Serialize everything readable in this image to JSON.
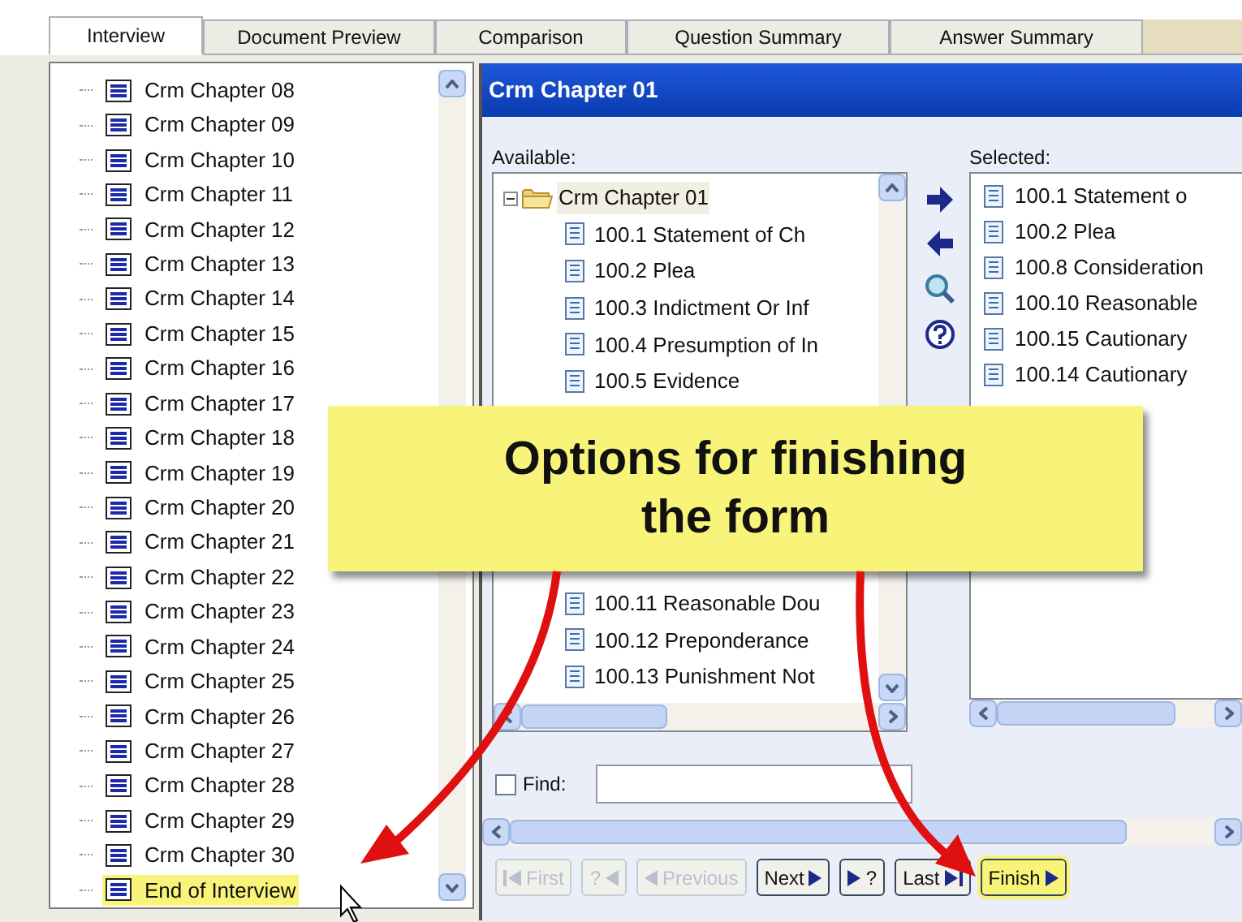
{
  "tabs": [
    {
      "label": "Interview",
      "selected": true
    },
    {
      "label": "Document Preview",
      "selected": false
    },
    {
      "label": "Comparison",
      "selected": false
    },
    {
      "label": "Question Summary",
      "selected": false
    },
    {
      "label": "Answer Summary",
      "selected": false
    }
  ],
  "outline": {
    "items": [
      {
        "label": "Crm Chapter 08",
        "selected": false
      },
      {
        "label": "Crm Chapter 09",
        "selected": false
      },
      {
        "label": "Crm Chapter 10",
        "selected": false
      },
      {
        "label": "Crm Chapter 11",
        "selected": false
      },
      {
        "label": "Crm Chapter 12",
        "selected": false
      },
      {
        "label": "Crm Chapter 13",
        "selected": false
      },
      {
        "label": "Crm Chapter 14",
        "selected": false
      },
      {
        "label": "Crm Chapter 15",
        "selected": false
      },
      {
        "label": "Crm Chapter 16",
        "selected": false
      },
      {
        "label": "Crm Chapter 17",
        "selected": false
      },
      {
        "label": "Crm Chapter 18",
        "selected": false
      },
      {
        "label": "Crm Chapter 19",
        "selected": false
      },
      {
        "label": "Crm Chapter 20",
        "selected": false
      },
      {
        "label": "Crm Chapter 21",
        "selected": false
      },
      {
        "label": "Crm Chapter 22",
        "selected": false
      },
      {
        "label": "Crm Chapter 23",
        "selected": false
      },
      {
        "label": "Crm Chapter 24",
        "selected": false
      },
      {
        "label": "Crm Chapter 25",
        "selected": false
      },
      {
        "label": "Crm Chapter 26",
        "selected": false
      },
      {
        "label": "Crm Chapter 27",
        "selected": false
      },
      {
        "label": "Crm Chapter 28",
        "selected": false
      },
      {
        "label": "Crm Chapter 29",
        "selected": false
      },
      {
        "label": "Crm Chapter 30",
        "selected": false
      },
      {
        "label": "End of Interview",
        "selected": true
      }
    ]
  },
  "panel": {
    "title": "Crm Chapter 01",
    "available": {
      "label": "Available:",
      "tree": [
        {
          "label": "Crm Chapter 01",
          "expanded": true,
          "selected": true,
          "children": [
            {
              "label": "100.1  Statement of Ch"
            },
            {
              "label": "100.2 Plea"
            },
            {
              "label": "100.3 Indictment Or Inf"
            },
            {
              "label": "100.4 Presumption of In"
            },
            {
              "label": "100.5 Evidence"
            },
            {
              "label": "100.11 Reasonable Dou"
            },
            {
              "label": "100.12 Preponderance"
            },
            {
              "label": "100.13 Punishment Not"
            }
          ]
        }
      ]
    },
    "selected": {
      "label": "Selected:",
      "items": [
        "100.1  Statement o",
        "100.2 Plea",
        "100.8 Consideration",
        "100.10 Reasonable",
        "100.15 Cautionary",
        "100.14 Cautionary"
      ]
    },
    "find": {
      "label": "Find:",
      "checked": false
    }
  },
  "buttons": [
    {
      "kind": "first",
      "label": "First",
      "disabled": true
    },
    {
      "kind": "prev-question",
      "label": "?",
      "disabled": true
    },
    {
      "kind": "previous",
      "label": "Previous",
      "disabled": true
    },
    {
      "kind": "next",
      "label": "Next",
      "disabled": false
    },
    {
      "kind": "next-question",
      "label": "?",
      "disabled": false
    },
    {
      "kind": "last",
      "label": "Last",
      "disabled": false
    },
    {
      "kind": "finish",
      "label": "Finish",
      "disabled": false,
      "highlighted": true
    }
  ],
  "callout": {
    "lines": [
      "Options for finishing",
      "the form"
    ]
  }
}
